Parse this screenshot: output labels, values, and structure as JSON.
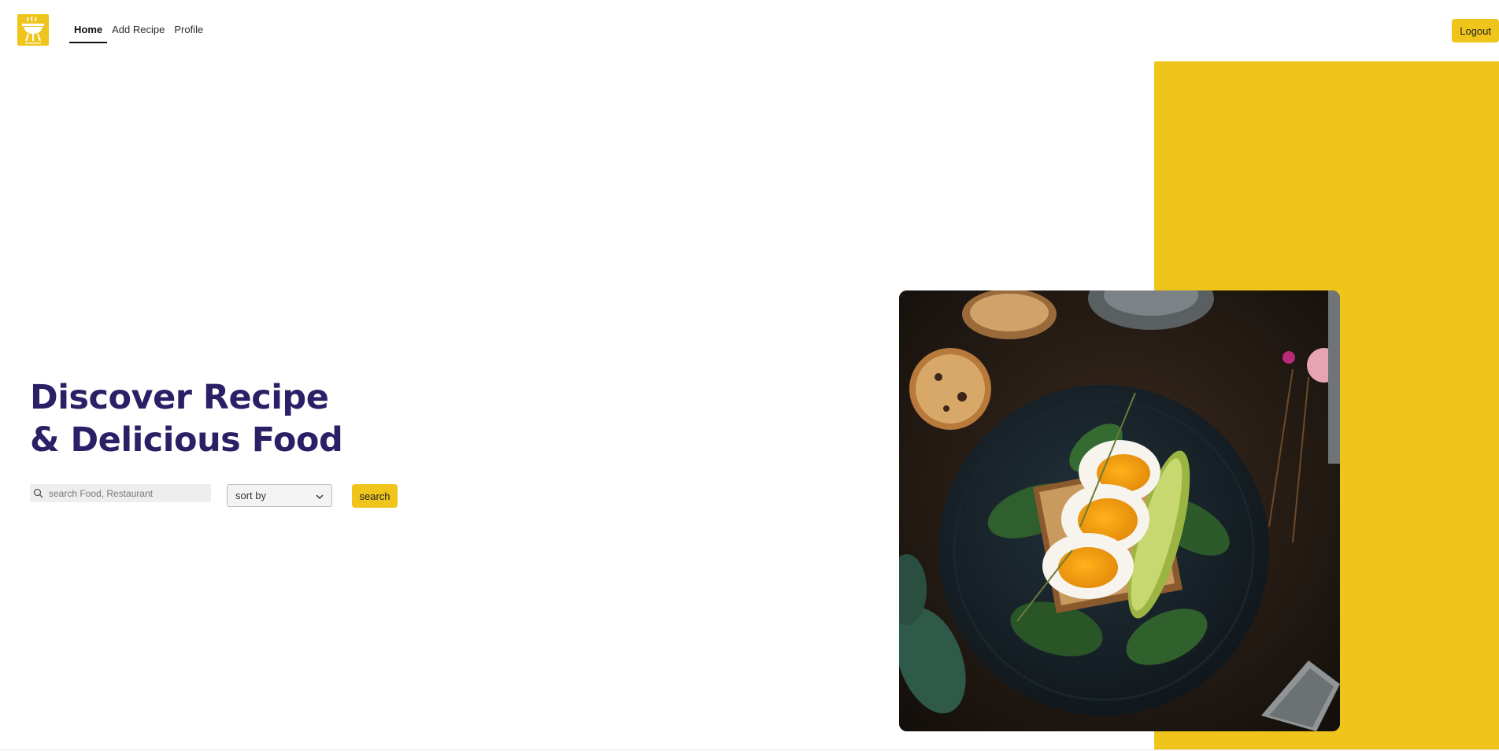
{
  "header": {
    "logo_icon": "grill-logo-icon",
    "nav": [
      {
        "label": "Home",
        "active": true
      },
      {
        "label": "Add Recipe",
        "active": false
      },
      {
        "label": "Profile",
        "active": false
      }
    ],
    "logout_label": "Logout"
  },
  "hero": {
    "title_line1": "Discover Recipe",
    "title_line2": "& Delicious Food"
  },
  "search": {
    "placeholder": "search Food, Restaurant",
    "sort_label": "sort by",
    "button_label": "search"
  },
  "image": {
    "subject": "egg-avocado-toast-photo"
  },
  "colors": {
    "accent": "#efc41b",
    "title": "#2b1f66"
  }
}
